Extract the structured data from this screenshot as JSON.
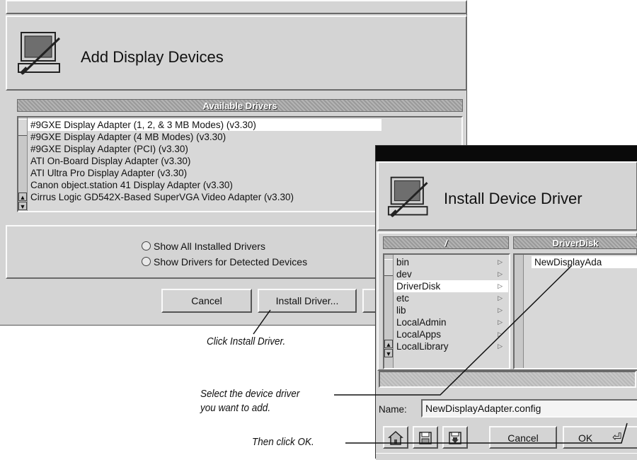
{
  "add_dialog": {
    "title": "Add Display Devices",
    "list_header": "Available Drivers",
    "drivers": [
      "#9GXE Display Adapter (1, 2, & 3 MB Modes) (v3.30)",
      "#9GXE Display Adapter (4 MB Modes) (v3.30)",
      "#9GXE Display Adapter (PCI) (v3.30)",
      "ATI On-Board Display Adapter (v3.30)",
      "ATI Ultra Pro Display Adapter (v3.30)",
      "Canon object.station 41 Display Adapter (v3.30)",
      "Cirrus Logic GD542X-Based SuperVGA Video Adapter (v3.30)"
    ],
    "selected_index": 0,
    "radio_all": "Show All Installed Drivers",
    "radio_detected": "Show Drivers for Detected Devices",
    "cancel_label": "Cancel",
    "install_label": "Install Driver..."
  },
  "install_dialog": {
    "title": "Install Device Driver",
    "left_header": "/",
    "right_header": "DriverDisk",
    "folders": [
      "bin",
      "dev",
      "DriverDisk",
      "etc",
      "lib",
      "LocalAdmin",
      "LocalApps",
      "LocalLibrary"
    ],
    "selected_folder_index": 2,
    "files": [
      "NewDisplayAda"
    ],
    "name_label": "Name:",
    "name_value": "NewDisplayAdapter.config",
    "cancel_label": "Cancel",
    "ok_label": "OK"
  },
  "captions": {
    "install": "Click Install Driver.",
    "select_line1": "Select the device driver",
    "select_line2": "you want to add.",
    "ok": "Then click OK."
  }
}
